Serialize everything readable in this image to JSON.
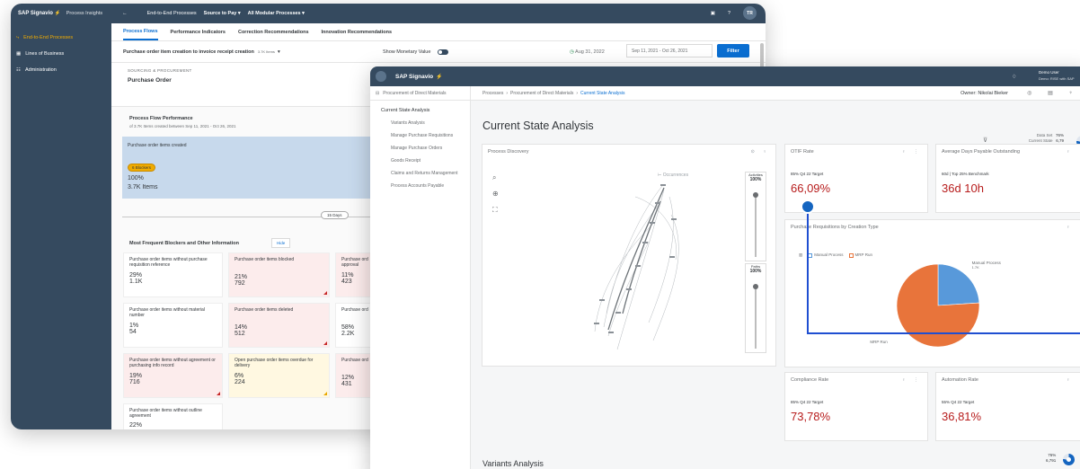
{
  "colors": {
    "shell": "#354a5f",
    "accent": "#0a6ed1",
    "brand_icon": "#f0ab00",
    "negative": "#b71c1c",
    "pie_blue": "#5899da",
    "pie_orange": "#e8743b"
  },
  "back_window": {
    "topbar": {
      "brand": "SAP Signavio",
      "app": "Process Insights",
      "back": "←",
      "crumbs": [
        "End-to-End Processes",
        "Source to Pay ▾",
        "All Modular Processes ▾"
      ],
      "user": "TR"
    },
    "sidebar": [
      {
        "label": "End-to-End Processes",
        "icon": "flow-icon",
        "active": true
      },
      {
        "label": "Lines of Business",
        "icon": "building-icon",
        "active": false
      },
      {
        "label": "Administration",
        "icon": "admin-icon",
        "active": false
      }
    ],
    "tabs": [
      "Process Flows",
      "Performance Indicators",
      "Correction Recommendations",
      "Innovation Recommendations"
    ],
    "filter": {
      "selection": "Purchase order item creation to invoice receipt creation",
      "selection_count": "3.7K Items",
      "monetary_label": "Show Monetary Value",
      "date_icon": "Aug 31, 2022",
      "date_range": "Sep 11, 2021 - Oct 26, 2021",
      "filter_button": "Filter"
    },
    "stage": {
      "category": "SOURCING & PROCUREMENT",
      "name": "Purchase Order"
    },
    "flow": {
      "title": "Process Flow Performance",
      "subtitle": "of 3.7K Items created between Sep 11, 2021 - Oct 26, 2021",
      "step": "Purchase order items created",
      "blockers_badge": "6 Blockers",
      "percent": "100%",
      "count": "3.7K Items",
      "days": "15 Days"
    },
    "blockers": {
      "title": "Most Frequent Blockers and Other Information",
      "hide": "Hide",
      "cells": [
        {
          "label": "Purchase order items without purchase requisition reference",
          "percent": "29%",
          "count": "1.1K",
          "tone": "white"
        },
        {
          "label": "Purchase order items blocked",
          "percent": "21%",
          "count": "792",
          "tone": "red"
        },
        {
          "label": "Purchase ord approval",
          "percent": "11%",
          "count": "423",
          "tone": "red"
        },
        {
          "label": "Purchase order items without material number",
          "percent": "1%",
          "count": "54",
          "tone": "white"
        },
        {
          "label": "Purchase order items deleted",
          "percent": "14%",
          "count": "512",
          "tone": "red"
        },
        {
          "label": "Purchase ord",
          "percent": "58%",
          "count": "2.2K",
          "tone": "white"
        },
        {
          "label": "Purchase order items without agreement or purchasing info record",
          "percent": "19%",
          "count": "716",
          "tone": "red"
        },
        {
          "label": "Open purchase order items overdue for delivery",
          "percent": "6%",
          "count": "224",
          "tone": "yellow"
        },
        {
          "label": "Purchase ord",
          "percent": "12%",
          "count": "431",
          "tone": "red"
        },
        {
          "label": "Purchase order items without outline agreement",
          "percent": "22%",
          "count": "",
          "tone": "white"
        }
      ]
    }
  },
  "front_window": {
    "topbar": {
      "brand": "SAP Signavio",
      "user_name": "Demo User",
      "user_sub": "Demo: RISE with SAP"
    },
    "nav_header": "Procurement of Direct Materials",
    "nav_current": "Current State Analysis",
    "nav_links": [
      "Variants Analysis",
      "Manage Purchase Requisitions",
      "Manage Purchase Orders",
      "Goods Receipt",
      "Claims and Returns Management",
      "Process Accounts Payable"
    ],
    "breadcrumb": [
      "Processes",
      "Procurement of Direct Materials",
      "Current State Analysis"
    ],
    "owner": "Owner: Nikolai Bieker",
    "title": "Current State Analysis",
    "dataset": {
      "label": "Data Set",
      "value": "Current State",
      "pct": "76%",
      "count": "6,79"
    },
    "process_discovery": {
      "title": "Process Discovery",
      "occurrences": "Occurrences",
      "activities_label": "Activities",
      "activities_pct": "100%",
      "paths_label": "Paths",
      "paths_pct": "100%"
    },
    "otif": {
      "title": "OTIF Rate",
      "sub": "85% Q4 22 Target",
      "value": "66,09%"
    },
    "dpo": {
      "title": "Average Days Payable Outstanding",
      "sub": "60d | Top 25% Benchmark",
      "value": "36d 10h"
    },
    "pr_creation": {
      "title": "Purchase Requisitions by Creation Type",
      "legend": [
        "Manual Process",
        "MRP Run"
      ]
    },
    "compliance": {
      "title": "Compliance Rate",
      "sub": "85% Q4 22 Target",
      "value": "73,78%"
    },
    "automation": {
      "title": "Automation Rate",
      "sub": "55% Q4 22 Target",
      "value": "36,81%"
    },
    "variants": {
      "title": "Variants Analysis",
      "pct": "76%",
      "count": "6,791"
    }
  },
  "chart_data": {
    "type": "pie",
    "title": "Purchase Requisitions by Creation Type",
    "categories": [
      "Manual Process",
      "MRP Run"
    ],
    "values": [
      0.24,
      0.76
    ],
    "labels": [
      "Manual Process",
      "MRP Run"
    ],
    "slice_counts": [
      "1.7K",
      ""
    ]
  }
}
